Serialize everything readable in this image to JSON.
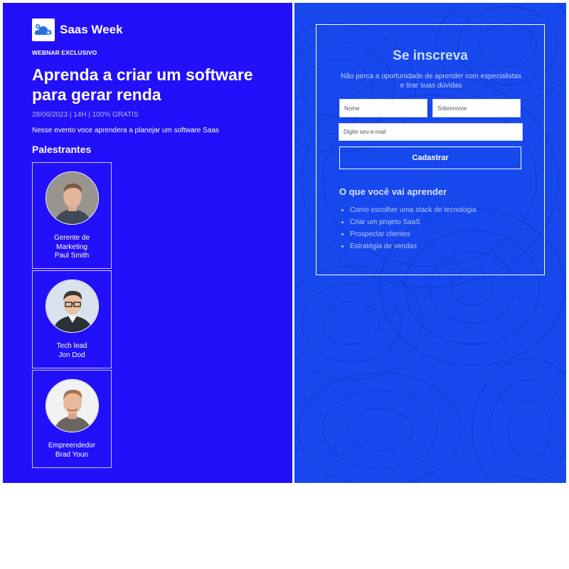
{
  "brand": {
    "name": "Saas Week",
    "logo_icon": "cloud-gear-icon",
    "colors": {
      "left_bg": "#2210fb",
      "right_bg": "#1648ee",
      "logo_cloud": "#2a6fe0"
    }
  },
  "hero": {
    "eyebrow": "WEBNAR EXCLUSIVO",
    "headline": "Aprenda a criar um software para gerar renda",
    "meta": "28/06/2023 | 14H | 100% GRATIS",
    "description": "Nesse evento voce aprendera a planejar um software Saas"
  },
  "speakers": {
    "title": "Palestrantes",
    "items": [
      {
        "role": "Gerente de Marketing",
        "name": "Paul Smith"
      },
      {
        "role": "Tech lead",
        "name": "Jon Dod"
      },
      {
        "role": "Empreendedor",
        "name": "Brad Youn"
      }
    ]
  },
  "signup": {
    "title": "Se inscreva",
    "subtitle": "Não perca a oportunidade de aprender com especialistas e tirar suas dúvidas",
    "first_name_placeholder": "Nome",
    "last_name_placeholder": "Sobrenome",
    "email_placeholder": "Digite seu e-mail",
    "submit_label": "Cadastrar"
  },
  "learn": {
    "title": "O que você vai aprender",
    "items": [
      "Como escolher uma stack de tecnologia",
      "Criar um projeto SaaS",
      "Prospectar clientes",
      "Estratégia de vendas"
    ]
  }
}
